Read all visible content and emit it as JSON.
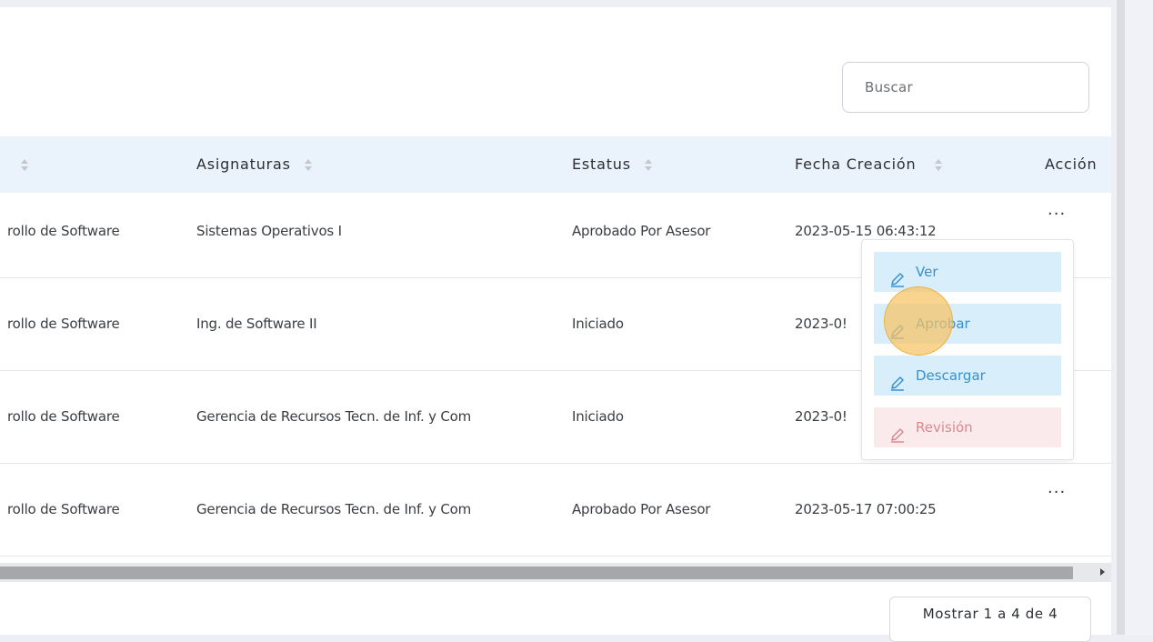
{
  "search": {
    "placeholder": "Buscar"
  },
  "table": {
    "headers": [
      {
        "label": ""
      },
      {
        "label": "Asignaturas"
      },
      {
        "label": "Estatus"
      },
      {
        "label": "Fecha Creación"
      },
      {
        "label": "Acción"
      }
    ],
    "rows": [
      {
        "carrera": "rollo de Software",
        "asignatura": "Sistemas Operativos I",
        "estatus": "Aprobado Por Asesor",
        "fecha": "2023-05-15 06:43:12"
      },
      {
        "carrera": "rollo de Software",
        "asignatura": "Ing. de Software II",
        "estatus": "Iniciado",
        "fecha": "2023-0!"
      },
      {
        "carrera": "rollo de Software",
        "asignatura": "Gerencia de Recursos Tecn. de Inf. y Com",
        "estatus": "Iniciado",
        "fecha": "2023-0!"
      },
      {
        "carrera": "rollo de Software",
        "asignatura": "Gerencia de Recursos Tecn. de Inf. y Com",
        "estatus": "Aprobado Por Asesor",
        "fecha": "2023-05-17 07:00:25"
      }
    ],
    "action_glyph": "..."
  },
  "dropdown": {
    "items": [
      {
        "label": "Ver",
        "icon": "pencil-icon"
      },
      {
        "label": "Aprobar",
        "icon": "pencil-icon"
      },
      {
        "label": "Descargar",
        "icon": "pencil-icon"
      },
      {
        "label": "Revisión",
        "icon": "pencil-icon"
      }
    ]
  },
  "pagination": {
    "info": "Mostrar 1 a 4 de 4"
  },
  "colors": {
    "header_bg": "#eaf3fc",
    "info_btn_bg": "#d8eefa",
    "info_btn_text": "#3a8fcf",
    "danger_btn_bg": "#fbeaec",
    "danger_btn_text": "#d9898f"
  }
}
